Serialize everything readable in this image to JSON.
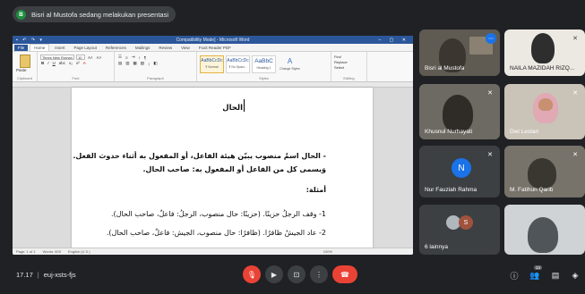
{
  "banner": {
    "initial": "B",
    "text": "Bisri al Mustofa sedang melakukan presentasi"
  },
  "word": {
    "window_title": "Compatibility Mode] - Microsoft Word",
    "tabs": [
      "File",
      "Home",
      "Insert",
      "Page Layout",
      "References",
      "Mailings",
      "Review",
      "View",
      "Foxit Reader PDF"
    ],
    "font_name": "Times New Roman",
    "font_size": "10",
    "groups": {
      "clipboard": "Clipboard",
      "font": "Font",
      "paragraph": "Paragraph",
      "styles": "Styles",
      "editing": "Editing"
    },
    "paste_label": "Paste",
    "styles": [
      {
        "sample": "AaBbCcDc",
        "name": "¶ Normal"
      },
      {
        "sample": "AaBbCcDc",
        "name": "¶ No Spaci..."
      },
      {
        "sample": "AaBbC",
        "name": "Heading 1"
      }
    ],
    "change_styles": "Change Styles",
    "editing_items": [
      "Find",
      "Replace",
      "Select"
    ],
    "status_page": "Page: 1 of 1",
    "status_words": "Words: 609",
    "status_lang": "English (U.S.)",
    "status_zoom": "100%"
  },
  "document": {
    "heading": "الحال",
    "paragraph_line1": "- الحال اسمٌ منصوب يبيّن هيئة الفاعل، أو المفعول به أثناء حدوث الفعل.",
    "paragraph_line2": "وَيسمى كل من الفاعل أو المفعول به: صاحب الحال.",
    "examples_title": "أمثلة:",
    "example1": "1- وقف الرجلُ حزينًا. (حزينًا: حال منصوب، الرجلُ: فاعلٌ، صاحب الحال).",
    "example2": "2- عاد الجيشُ ظافرًا. (ظافرًا: حال منصوب، الجيش: فاعلٌ، صاحب الحال)."
  },
  "participants": [
    {
      "name": "Bisri al Mustofa"
    },
    {
      "name": "NAILA MAZIDAH RIZQ..."
    },
    {
      "name": "Khusnul Nurhayati"
    },
    {
      "name": "Dwi Lestari"
    },
    {
      "name": "Nur Fauziah Rahma",
      "initial": "N"
    },
    {
      "name": "M. Fatihun Qarib"
    },
    {
      "name": "6 lainnya",
      "initial": "S"
    },
    {
      "name": ""
    }
  ],
  "meeting": {
    "time": "17.17",
    "separator": "|",
    "code": "euj-xsts-fjs",
    "people_count": "14"
  },
  "icons": {
    "mic_off": "mic-off-icon",
    "camera_off": "camera-off-icon",
    "present": "present-icon",
    "more": "more-options-icon",
    "hangup": "hangup-icon",
    "info": "info-icon",
    "people": "people-icon",
    "chat": "chat-icon",
    "activities": "activities-icon"
  },
  "colors": {
    "background": "#202124",
    "tile": "#3c4043",
    "red": "#ea4335",
    "accent_blue": "#1a73e8",
    "word_blue": "#2b579a"
  }
}
